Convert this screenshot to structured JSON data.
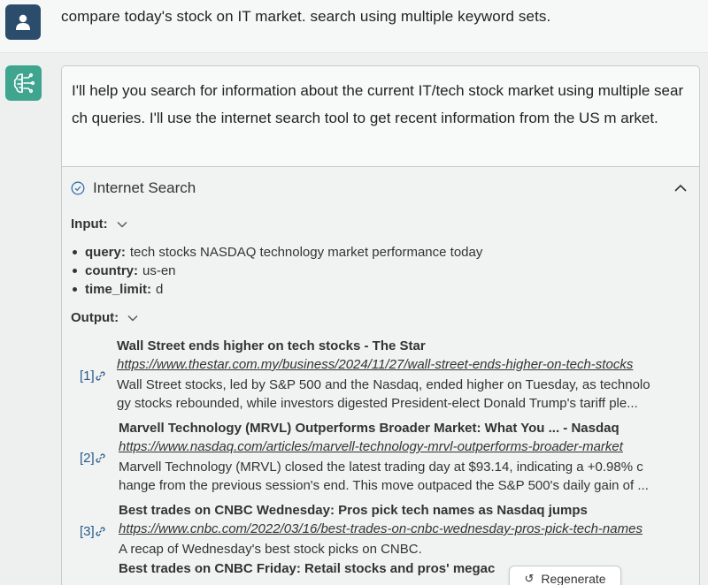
{
  "user_message": "compare today's stock on IT market. search using multiple keyword sets.",
  "assistant": {
    "intro": "I'll help you search for information about the current IT/tech stock market using multiple search queries. I'll use the internet search tool to get recent information from the US m arket."
  },
  "tool": {
    "title": "Internet Search",
    "input_label": "Input:",
    "output_label": "Output:",
    "params": [
      {
        "key": "query:",
        "value": "tech stocks NASDAQ technology market performance today"
      },
      {
        "key": "country:",
        "value": "us-en"
      },
      {
        "key": "time_limit:",
        "value": "d"
      }
    ],
    "results": [
      {
        "ref": "[1]",
        "title": "Wall Street ends higher on tech stocks - The Star",
        "url": "https://www.thestar.com.my/business/2024/11/27/wall-street-ends-higher-on-tech-stocks",
        "snippet_1": "Wall Street stocks, led by S&P 500 and the Nasdaq, ended higher on Tuesday, as technolo",
        "snippet_2": "gy stocks rebounded, while investors digested President-elect Donald Trump's tariff ple..."
      },
      {
        "ref": "[2]",
        "title": "Marvell Technology (MRVL) Outperforms Broader Market: What You ... - Nasdaq",
        "url": "https://www.nasdaq.com/articles/marvell-technology-mrvl-outperforms-broader-market",
        "snippet_1": "Marvell Technology (MRVL) closed the latest trading day at $93.14, indicating a +0.98% c",
        "snippet_2": "hange from the previous session's end. This move outpaced the S&P 500's daily gain of ..."
      },
      {
        "ref": "[3]",
        "title": "Best trades on CNBC Wednesday: Pros pick tech names as Nasdaq jumps",
        "url": "https://www.cnbc.com/2022/03/16/best-trades-on-cnbc-wednesday-pros-pick-tech-names",
        "snippet_1": "A recap of Wednesday's best stock picks on CNBC.",
        "snippet_2": ""
      },
      {
        "ref": "",
        "title": "Best trades on CNBC Friday: Retail stocks and pros' megac",
        "url": "",
        "snippet_1": "",
        "snippet_2": ""
      }
    ]
  },
  "regenerate_label": "Regenerate",
  "colors": {
    "user_avatar": "#2b4d6b",
    "bot_avatar": "#3fa58f",
    "link": "#2a5a8a"
  }
}
